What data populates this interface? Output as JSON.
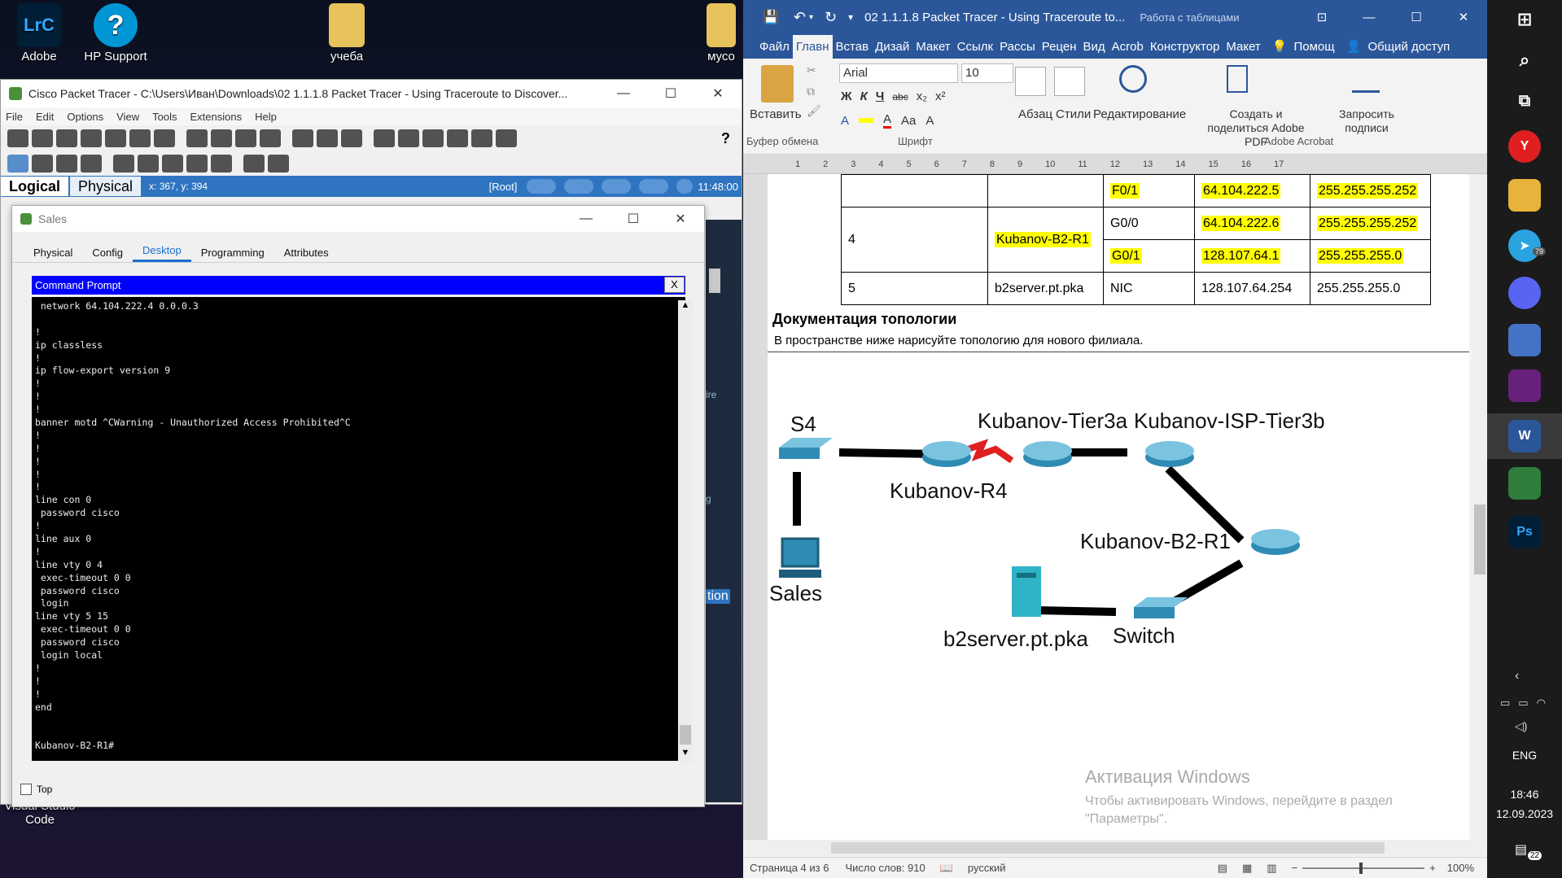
{
  "desktop": {
    "icons": [
      {
        "label": "Adobe",
        "glyph": "LrC"
      },
      {
        "label": "HP Support",
        "glyph": "?"
      },
      {
        "label": "учеба",
        "glyph": ""
      },
      {
        "label": "мусо",
        "glyph": ""
      }
    ],
    "vscode_label": "Visual Studio Code"
  },
  "pt": {
    "title": "Cisco Packet Tracer - C:\\Users\\Иван\\Downloads\\02 1.1.1.8 Packet Tracer - Using Traceroute to Discover...",
    "menu": [
      "File",
      "Edit",
      "Options",
      "View",
      "Tools",
      "Extensions",
      "Help"
    ],
    "mode_tabs": [
      "Logical",
      "Physical"
    ],
    "coords": "x: 367, y: 394",
    "root": "[Root]",
    "time": "11:48:00",
    "side_labels": [
      "ire",
      "g",
      "tion"
    ]
  },
  "sales": {
    "title": "Sales",
    "tabs": [
      "Physical",
      "Config",
      "Desktop",
      "Programming",
      "Attributes"
    ],
    "selected_tab": "Desktop",
    "cmd_title": "Command Prompt",
    "close_label": "X",
    "console_lines": [
      " network 64.104.222.4 0.0.0.3",
      "",
      "!",
      "ip classless",
      "!",
      "ip flow-export version 9",
      "!",
      "!",
      "!",
      "banner motd ^CWarning - Unauthorized Access Prohibited^C",
      "!",
      "!",
      "!",
      "!",
      "!",
      "line con 0",
      " password cisco",
      "!",
      "line aux 0",
      "!",
      "line vty 0 4",
      " exec-timeout 0 0",
      " password cisco",
      " login",
      "line vty 5 15",
      " exec-timeout 0 0",
      " password cisco",
      " login local",
      "!",
      "!",
      "!",
      "end",
      "",
      "",
      "Kubanov-B2-R1#"
    ],
    "top_checkbox": "Top"
  },
  "word": {
    "title": "02 1.1.1.8 Packet Tracer - Using Traceroute to...",
    "context_label": "Работа с таблицами",
    "tabs": [
      "Файл",
      "Главн",
      "Встав",
      "Дизай",
      "Макет",
      "Ссылк",
      "Рассы",
      "Рецен",
      "Вид",
      "Acrob",
      "Конструктор",
      "Макет"
    ],
    "selected_tab": "Главн",
    "help": "Помощ",
    "share": "Общий доступ",
    "ribbon": {
      "paste": "Вставить",
      "clipboard": "Буфер обмена",
      "font_name": "Arial",
      "font_size": "10",
      "font_group": "Шрифт",
      "paragraph": "Абзац",
      "styles": "Стили",
      "editing": "Редактирование",
      "create_pdf": "Создать и поделиться Adobe PDF",
      "request_sign": "Запросить подписи",
      "acrobat": "Adobe Acrobat",
      "format_buttons": [
        "Ж",
        "К",
        "Ч",
        "abc",
        "x₂",
        "x²",
        "A",
        "Aa",
        "A",
        "A"
      ]
    },
    "ruler_ticks": [
      "1",
      "2",
      "3",
      "4",
      "5",
      "6",
      "7",
      "8",
      "9",
      "10",
      "11",
      "12",
      "13",
      "14",
      "15",
      "16",
      "17"
    ],
    "table": [
      {
        "dev": "",
        "host": "",
        "iface": "F0/1",
        "ip": "64.104.222.5",
        "mask": "255.255.255.252",
        "hl": true
      },
      {
        "dev": "4",
        "host": "Kubanov-B2-R1",
        "iface": "G0/0",
        "ip": "64.104.222.6",
        "mask": "255.255.255.252",
        "hl": false
      },
      {
        "dev": "",
        "host": "",
        "iface": "G0/1",
        "ip": "128.107.64.1",
        "mask": "255.255.255.0",
        "hl": true
      },
      {
        "dev": "5",
        "host": "b2server.pt.pka",
        "iface": "NIC",
        "ip": "128.107.64.254",
        "mask": "255.255.255.0",
        "hl": false
      }
    ],
    "heading": "Документация топологии",
    "subtext": "В пространстве ниже нарисуйте топологию для нового филиала.",
    "topology_labels": {
      "s4": "S4",
      "r4": "Kubanov-R4",
      "tier3a": "Kubanov-Tier3a",
      "tier3b": "Kubanov-ISP-Tier3b",
      "b2r1": "Kubanov-B2-R1",
      "sales": "Sales",
      "server": "b2server.pt.pka",
      "switch": "Switch"
    },
    "watermark_title": "Активация Windows",
    "watermark_text": "Чтобы активировать Windows, перейдите в раздел \"Параметры\".",
    "status": {
      "page": "Страница 4 из 6",
      "words": "Число слов: 910",
      "lang": "русский",
      "zoom": "100%"
    }
  },
  "taskbar": {
    "lang": "ENG",
    "time": "18:46",
    "date": "12.09.2023",
    "notif": "22",
    "badges": [
      "79"
    ]
  }
}
